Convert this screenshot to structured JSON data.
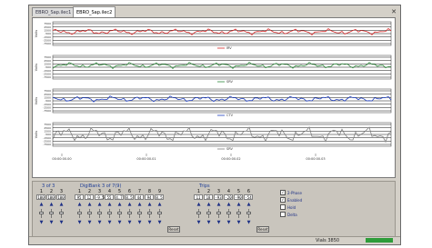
{
  "tabs": [
    {
      "label": "EBRO_Sap.ilec1",
      "active": false
    },
    {
      "label": "EBRO_Sap.ilec2",
      "active": true
    }
  ],
  "colors": {
    "series": [
      "#d62b2b",
      "#2f8a3c",
      "#1f3fbf",
      "#808080"
    ],
    "grid": "#111111",
    "status_progress": "#2e9c3a"
  },
  "panels": [
    {
      "legend": "IRV",
      "ylabel": "Volts",
      "yticks": [
        "7500",
        "2500",
        "1500",
        "-500",
        "-1500",
        "-2500",
        "-7500"
      ]
    },
    {
      "legend": "SRV",
      "ylabel": "Volts",
      "yticks": [
        "7500",
        "2500",
        "1500",
        "-500",
        "-1500",
        "-2500",
        "-7500"
      ]
    },
    {
      "legend": "CTV",
      "ylabel": "Volts",
      "yticks": [
        "7500",
        "2500",
        "1500",
        "-500",
        "-1500",
        "-2500",
        "-7500"
      ]
    },
    {
      "legend": "SRV",
      "ylabel": "Volts",
      "yticks": [
        "7500",
        "2500",
        "1500",
        "-500",
        "-1500",
        "-2500",
        "-7500"
      ]
    }
  ],
  "time_ticks": [
    "00:00:00.00",
    "00:00:00.01",
    "00:00:00.02",
    "00:00:00.03"
  ],
  "controls": {
    "group1": {
      "label": "3 of 3",
      "headers": [
        "1",
        "2",
        "3"
      ],
      "values": [
        "100",
        "100",
        "100"
      ]
    },
    "group2": {
      "label": "DigiBank 3 of 7(9)",
      "headers": [
        "1",
        "2",
        "3",
        "4",
        "5",
        "6",
        "7",
        "8",
        "9"
      ],
      "values": [
        "95",
        "12",
        "-9.5",
        "55",
        "4.7",
        "8.5",
        "44",
        "94",
        "8.5"
      ]
    },
    "group3": {
      "label": "Trips",
      "headers": [
        "1",
        "2",
        "3",
        "4",
        "5",
        "6"
      ],
      "values": [
        "11",
        "18",
        "-93",
        "-20",
        "-90",
        "-54"
      ]
    },
    "reset_label": "Reset",
    "options": [
      {
        "label": "2-Phase",
        "checked": true
      },
      {
        "label": "Enabled",
        "checked": true
      },
      {
        "label": "Hold",
        "checked": false
      },
      {
        "label": "Delta",
        "checked": false
      }
    ]
  },
  "status": {
    "text": "Vials 3850",
    "progress": 1.0
  }
}
